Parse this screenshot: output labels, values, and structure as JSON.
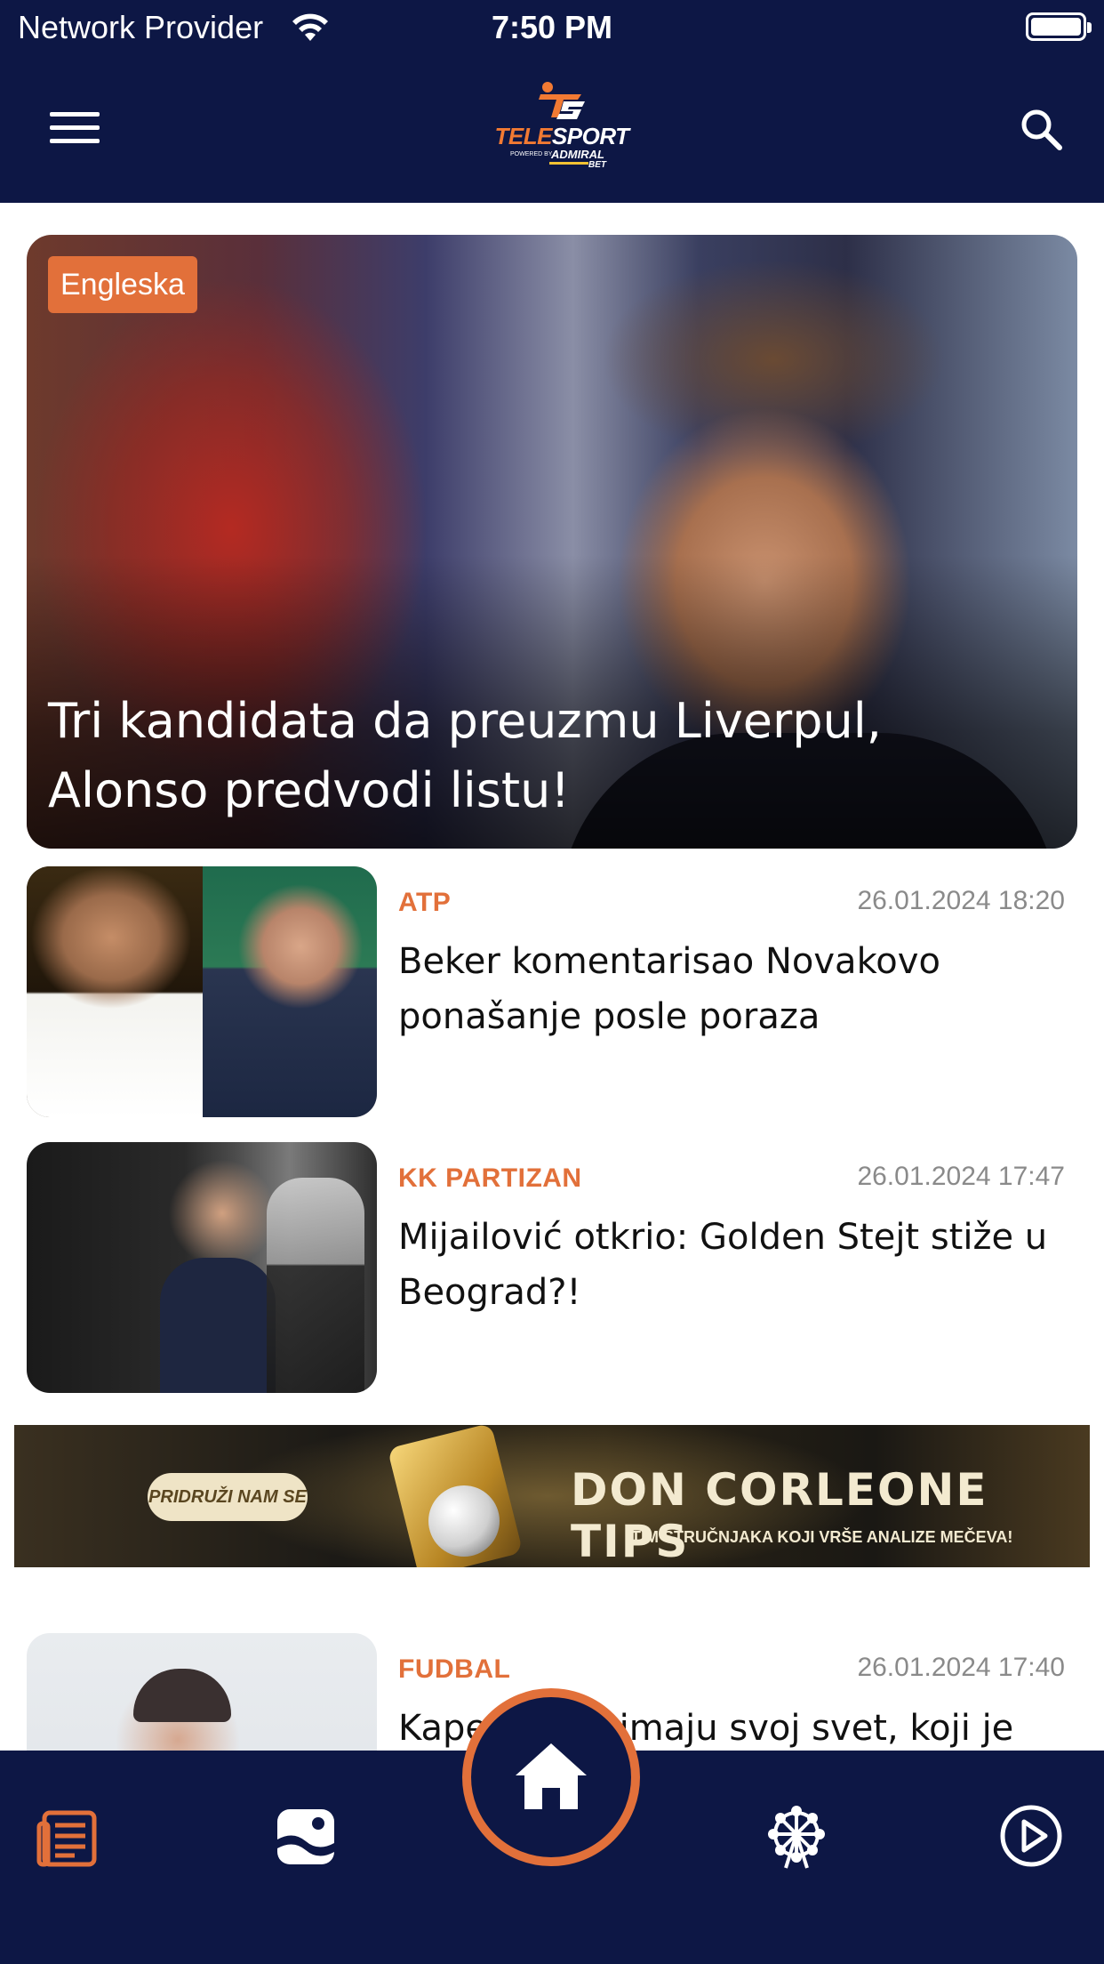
{
  "status_bar": {
    "carrier": "Network Provider",
    "time": "7:50 PM",
    "wifi_icon": "wifi-icon",
    "battery_icon": "battery-icon"
  },
  "header": {
    "logo": {
      "name_part1": "TELE",
      "name_part2": "SPORT",
      "powered": "POWERED BY",
      "sponsor": "ADMIRAL",
      "sponsor_suffix": "BET"
    },
    "menu_icon": "hamburger-menu-icon",
    "search_icon": "search-icon"
  },
  "hero": {
    "tag": "Engleska",
    "title": "Tri kandidata da preuzmu Liverpul, Alonso predvodi listu!"
  },
  "news": [
    {
      "category": "ATP",
      "date": "26.01.2024 18:20",
      "headline": "Beker komentarisao Novakovo ponašanje posle poraza"
    },
    {
      "category": "KK PARTIZAN",
      "date": "26.01.2024 17:47",
      "headline": "Mijailović otkrio: Golden Stejt stiže u Beograd?!"
    },
    {
      "category": "FUDBAL",
      "date": "26.01.2024 17:40",
      "headline": "Kape... ...ije imaju svoj svet, koji je"
    }
  ],
  "banner": {
    "button": "PRIDRUŽI NAM SE",
    "title": "DON CORLEONE TIPS",
    "subtitle": "TIM STRUČNJAKA KOJI VRŠE ANALIZE MEČEVA!"
  },
  "bottom_nav": {
    "items": [
      "news-icon",
      "scores-icon",
      "home-icon",
      "ferris-wheel-icon",
      "play-icon"
    ],
    "accent": "#e2703a",
    "background": "#0d1745"
  },
  "colors": {
    "primary": "#0d1745",
    "accent": "#e2703a"
  }
}
